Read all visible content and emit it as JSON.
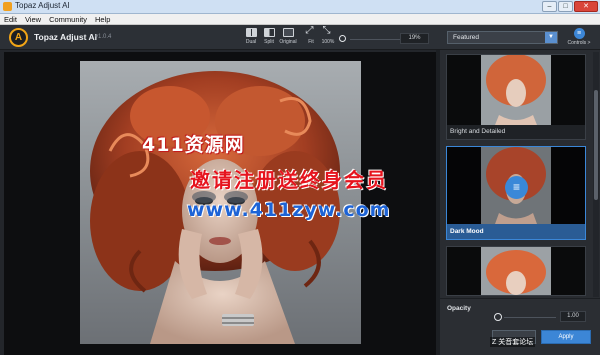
{
  "window": {
    "title": "Topaz Adjust AI",
    "close_glyph": "✕",
    "minimize_glyph": "–",
    "maximize_glyph": "□"
  },
  "menu": [
    "Edit",
    "View",
    "Community",
    "Help"
  ],
  "toolbar": {
    "logo_letter": "A",
    "app_name": "Topaz Adjust AI",
    "version": "v1.0.4",
    "view_buttons": [
      {
        "label": "Dual",
        "icon": "dual-view-icon"
      },
      {
        "label": "Split",
        "icon": "split-view-icon"
      },
      {
        "label": "Original",
        "icon": "original-view-icon"
      },
      {
        "label": "Fit",
        "icon": "fit-icon"
      },
      {
        "label": "100%",
        "icon": "zoom-100-icon"
      }
    ],
    "zoom_value": "19%"
  },
  "presets": {
    "category": "Featured",
    "controls_label": "Controls >",
    "cards": [
      {
        "caption": "Bright and Detailed",
        "active": false
      },
      {
        "caption": "Dark Mood",
        "active": true
      },
      {
        "caption": "",
        "active": false
      }
    ]
  },
  "opacity": {
    "label": "Opacity",
    "value": "1.00"
  },
  "actions": {
    "apply_label": "Apply"
  },
  "watermark": {
    "line1": "411资源网",
    "line2": "邀请注册送终身会员",
    "line3": "www.411zyw.com",
    "corner": "Z 关音套论坛"
  },
  "colors": {
    "accent": "#3c86d6",
    "logo": "#f2a516",
    "hair": "#b4482a"
  }
}
